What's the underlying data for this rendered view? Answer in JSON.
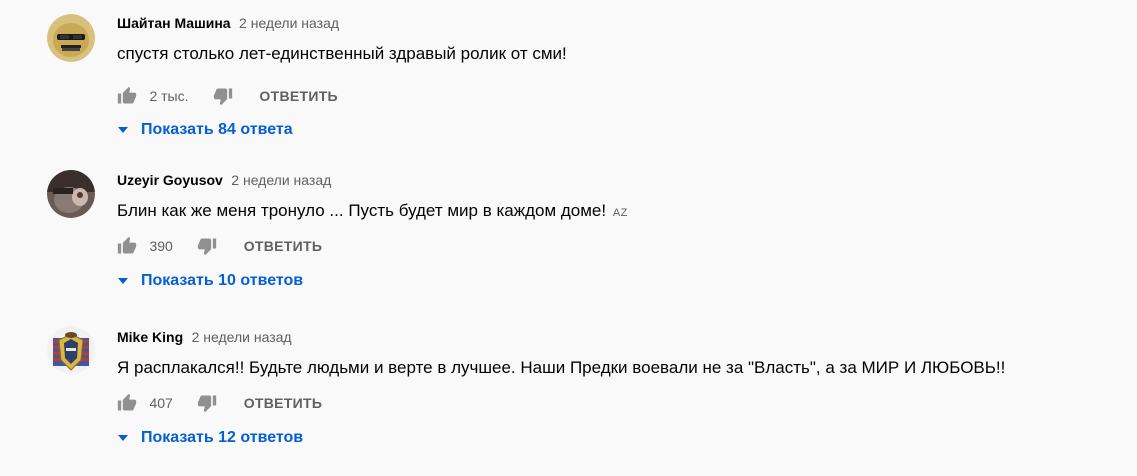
{
  "comments": [
    {
      "author": "Шайтан Машина",
      "time": "2 недели назад",
      "text": "спустя столько лет-единственный здравый ролик от сми!",
      "lang": "",
      "likes": "2 тыс.",
      "reply_label": "ОТВЕТИТЬ",
      "replies_label": "Показать 84 ответа"
    },
    {
      "author": "Uzeyir Goyusov",
      "time": "2 недели назад",
      "text": "Блин как же меня тронуло ... Пусть будет мир в каждом доме!",
      "lang": "AZ",
      "likes": "390",
      "reply_label": "ОТВЕТИТЬ",
      "replies_label": "Показать 10 ответов"
    },
    {
      "author": "Mike King",
      "time": "2 недели назад",
      "text": "Я расплакался!! Будьте людьми и верте в лучшее. Наши Предки воевали не за \"Власть\", а за МИР И ЛЮБОВЬ!!",
      "lang": "",
      "likes": "407",
      "reply_label": "ОТВЕТИТЬ",
      "replies_label": "Показать 12 ответов"
    }
  ],
  "colors": {
    "background": "#f9f9f9",
    "link": "#065fd4",
    "secondary_text": "#606060",
    "icon": "#909090"
  },
  "icons": {
    "like": "thumbs-up-icon",
    "dislike": "thumbs-down-icon",
    "expand": "caret-down-icon"
  }
}
